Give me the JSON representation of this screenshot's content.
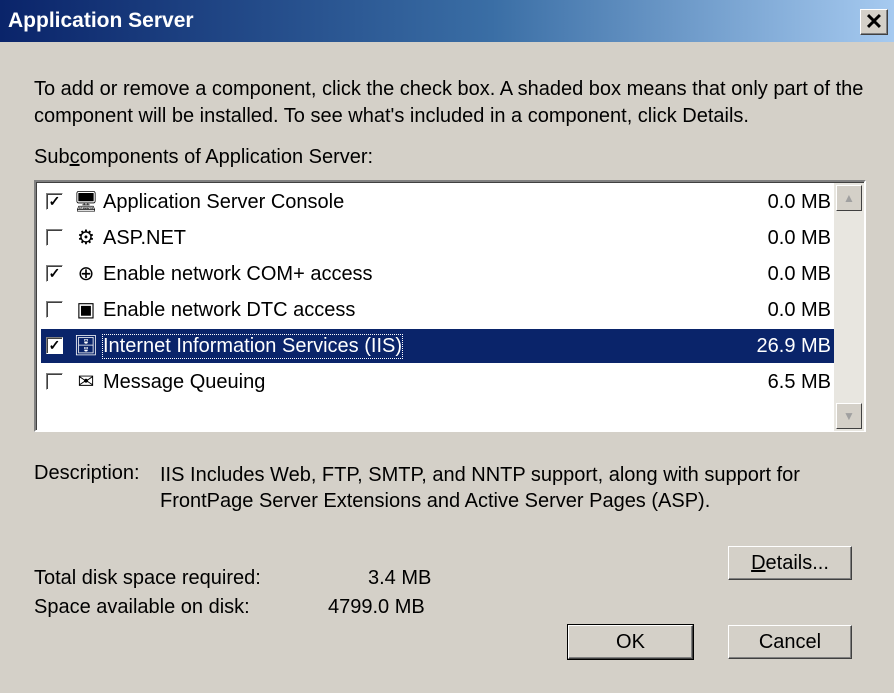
{
  "window": {
    "title": "Application Server",
    "close_glyph": "✕"
  },
  "intro": "To add or remove a component, click the check box. A shaded box means that only part of the component will be installed. To see what's included in a component, click Details.",
  "subcomponents_label_pre": "Sub",
  "subcomponents_label_accel": "c",
  "subcomponents_label_post": "omponents of Application Server:",
  "components": [
    {
      "name": "Application Server Console",
      "size": "0.0 MB",
      "checked": true,
      "icon": "console-icon",
      "glyph": "🖥"
    },
    {
      "name": "ASP.NET",
      "size": "0.0 MB",
      "checked": false,
      "icon": "aspnet-gears-icon",
      "glyph": "⚙"
    },
    {
      "name": "Enable network COM+ access",
      "size": "0.0 MB",
      "checked": true,
      "icon": "com-plus-icon",
      "glyph": "⊕"
    },
    {
      "name": "Enable network DTC access",
      "size": "0.0 MB",
      "checked": false,
      "icon": "dtc-icon",
      "glyph": "▣"
    },
    {
      "name": "Internet Information Services (IIS)",
      "size": "26.9 MB",
      "checked": true,
      "selected": true,
      "icon": "iis-server-icon",
      "glyph": "🗄"
    },
    {
      "name": "Message Queuing",
      "size": "6.5 MB",
      "checked": false,
      "icon": "message-queuing-icon",
      "glyph": "✉"
    }
  ],
  "description": {
    "label": "Description:",
    "text": "IIS Includes Web, FTP, SMTP, and NNTP support, along with support for FrontPage Server Extensions and Active Server Pages (ASP)."
  },
  "disk": {
    "total_label": "Total disk space required:",
    "total_value": "3.4 MB",
    "available_label": "Space available on disk:",
    "available_value": "4799.0 MB"
  },
  "buttons": {
    "details_accel": "D",
    "details_rest": "etails...",
    "ok": "OK",
    "cancel": "Cancel"
  },
  "colors": {
    "selection": "#0a246a",
    "dialog": "#d4d0c8"
  }
}
